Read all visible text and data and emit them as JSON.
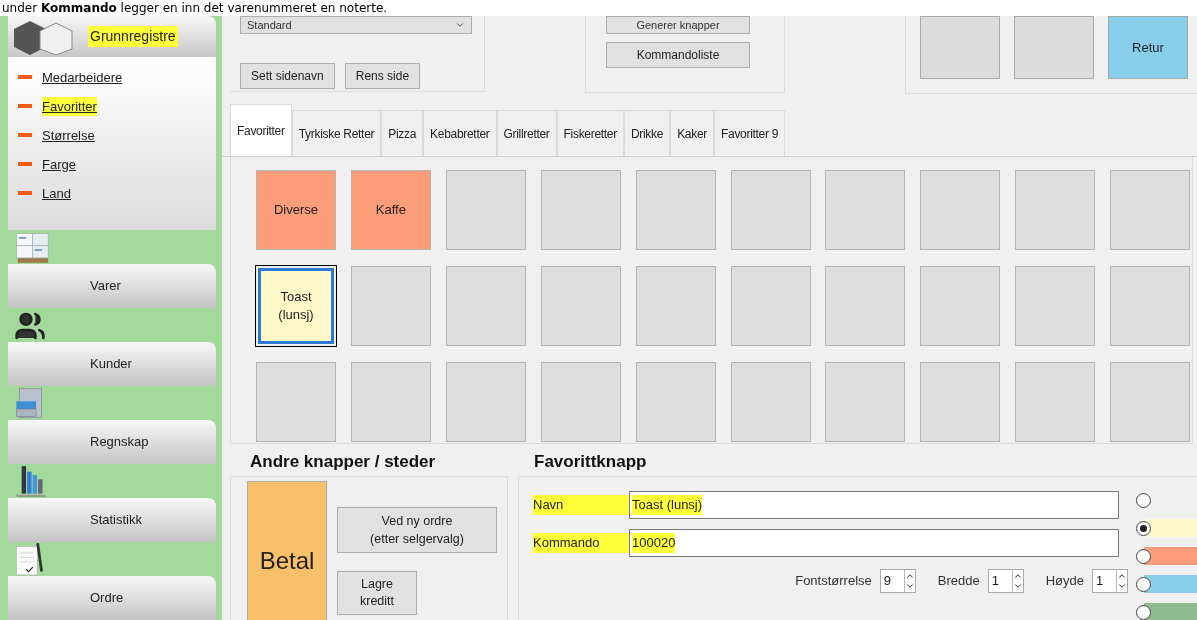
{
  "doc_text": "under **Kommando** legger en inn det varenummeret en noterte.",
  "sidebar": {
    "header": {
      "label": "Grunnregistre",
      "highlighted": true
    },
    "items": [
      {
        "label": "Medarbeidere",
        "highlighted": false
      },
      {
        "label": "Favoritter",
        "highlighted": true
      },
      {
        "label": "Størrelse",
        "highlighted": false
      },
      {
        "label": "Farge",
        "highlighted": false
      },
      {
        "label": "Land",
        "highlighted": false
      }
    ],
    "nav": [
      {
        "label": "Varer",
        "kind": "boxes"
      },
      {
        "label": "Kunder",
        "kind": "people"
      },
      {
        "label": "Regnskap",
        "kind": "cabinet"
      },
      {
        "label": "Statistikk",
        "kind": "chart"
      },
      {
        "label": "Ordre",
        "kind": "document"
      }
    ]
  },
  "toolbar": {
    "dropdown": {
      "value": "Standard"
    },
    "page_buttons": [
      "Sett sidenavn",
      "Rens side"
    ],
    "generate_buttons": [
      "Generer knapper",
      "Kommandoliste"
    ],
    "shortcuts": [
      {
        "color": "#dcdcdc"
      },
      {
        "color": "#dcdcdc"
      },
      {
        "label": "Retur",
        "color": "#87ceeb"
      }
    ]
  },
  "tabs": [
    {
      "label": "Favoritter",
      "selected": true
    },
    {
      "label": "Tyrkiske Retter",
      "selected": false
    },
    {
      "label": "Pizza",
      "selected": false
    },
    {
      "label": "Kebabretter",
      "selected": false
    },
    {
      "label": "Grillretter",
      "selected": false
    },
    {
      "label": "Fiskeretter",
      "selected": false
    },
    {
      "label": "Drikke",
      "selected": false
    },
    {
      "label": "Kaker",
      "selected": false
    },
    {
      "label": "Favoritter 9",
      "selected": false
    }
  ],
  "grid": [
    [
      {
        "label": "Diverse",
        "color": "#fc9d7a",
        "selected": false
      },
      {
        "label": "Kaffe",
        "color": "#fc9d7a",
        "selected": false
      },
      {
        "color": "#dedede",
        "selected": false
      },
      {
        "color": "#dedede",
        "selected": false
      },
      {
        "color": "#dedede",
        "selected": false
      },
      {
        "color": "#dedede",
        "selected": false
      },
      {
        "color": "#dedede",
        "selected": false
      },
      {
        "color": "#dedede",
        "selected": false
      },
      {
        "color": "#dedede",
        "selected": false
      },
      {
        "color": "#dedede",
        "selected": false
      }
    ],
    [
      {
        "label": "Toast\n(lunsj)",
        "color": "#fff8c8",
        "selected": true
      },
      {
        "color": "#dedede",
        "selected": false
      },
      {
        "color": "#dedede",
        "selected": false
      },
      {
        "color": "#dedede",
        "selected": false
      },
      {
        "color": "#dedede",
        "selected": false
      },
      {
        "color": "#dedede",
        "selected": false
      },
      {
        "color": "#dedede",
        "selected": false
      },
      {
        "color": "#dedede",
        "selected": false
      },
      {
        "color": "#dedede",
        "selected": false
      },
      {
        "color": "#dedede",
        "selected": false
      }
    ],
    [
      {
        "color": "#dedede",
        "selected": false
      },
      {
        "color": "#dedede",
        "selected": false
      },
      {
        "color": "#dedede",
        "selected": false
      },
      {
        "color": "#dedede",
        "selected": false
      },
      {
        "color": "#dedede",
        "selected": false
      },
      {
        "color": "#dedede",
        "selected": false
      },
      {
        "color": "#dedede",
        "selected": false
      },
      {
        "color": "#dedede",
        "selected": false
      },
      {
        "color": "#dedede",
        "selected": false
      },
      {
        "color": "#dedede",
        "selected": false
      }
    ]
  ],
  "other_buttons": {
    "title": "Andre knapper / steder",
    "buttons": [
      {
        "label": "Betal",
        "kind": "large",
        "color": "#f9c06b"
      },
      {
        "label": "Ved ny ordre\n(etter selgervalg)",
        "kind": "wide",
        "color": "#e1e1e1"
      },
      {
        "label": "Lagre\nkreditt",
        "kind": "small",
        "color": "#e1e1e1"
      }
    ]
  },
  "favorite_button": {
    "title": "Favorittknapp",
    "fields": [
      {
        "label": "Navn",
        "value": "Toast (lunsj)",
        "highlighted": true
      },
      {
        "label": "Kommando",
        "value": "100020",
        "highlighted": true
      }
    ],
    "spinners": [
      {
        "label": "Fontstørrelse",
        "value": "9"
      },
      {
        "label": "Bredde",
        "value": "1"
      },
      {
        "label": "Høyde",
        "value": "1"
      }
    ],
    "colors": [
      {
        "selected": false
      },
      {
        "color": "#fff8c8",
        "selected": true
      },
      {
        "color": "#fc9d7a",
        "selected": false
      },
      {
        "color": "#87ceeb",
        "selected": false
      },
      {
        "color": "#8fbc8f",
        "selected": false
      }
    ]
  }
}
